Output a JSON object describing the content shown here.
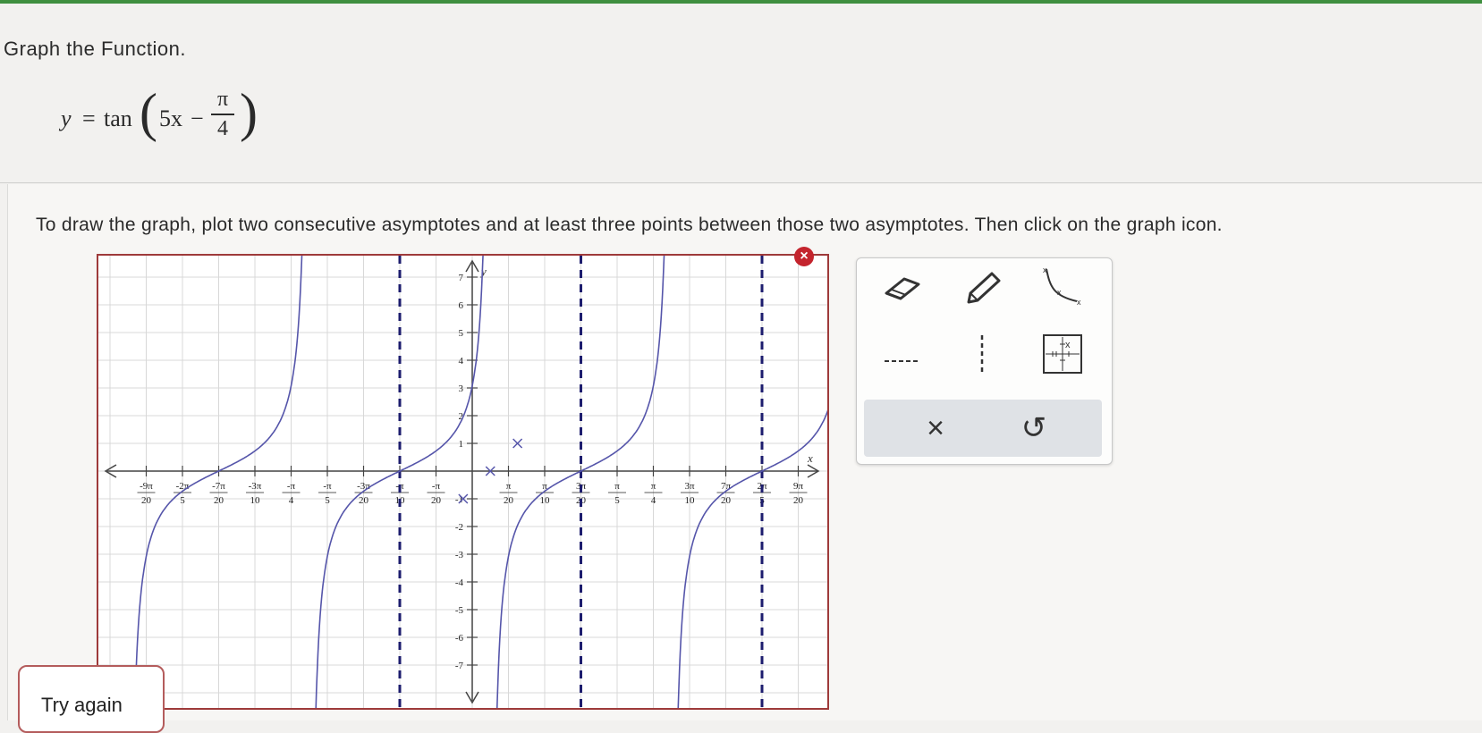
{
  "problem": {
    "title": "Graph the Function.",
    "formula": {
      "y": "y",
      "equals": "=",
      "func": "tan",
      "coef": "5x",
      "minus": "−",
      "num": "π",
      "den": "4"
    },
    "instructions": "To draw the graph, plot two consecutive asymptotes and at least three points between those two asymptotes. Then click on the graph icon."
  },
  "graph": {
    "axis_labels": {
      "x": "x",
      "y": "y"
    },
    "x_ticks": [
      {
        "num": "-9π",
        "den": "20",
        "v": -9
      },
      {
        "num": "-2π",
        "den": "5",
        "v": -8
      },
      {
        "num": "-7π",
        "den": "20",
        "v": -7
      },
      {
        "num": "-3π",
        "den": "10",
        "v": -6
      },
      {
        "num": "-π",
        "den": "4",
        "v": -5
      },
      {
        "num": "-π",
        "den": "5",
        "v": -4
      },
      {
        "num": "-3π",
        "den": "20",
        "v": -3
      },
      {
        "num": "-π",
        "den": "10",
        "v": -2
      },
      {
        "num": "-π",
        "den": "20",
        "v": -1
      },
      {
        "num": "π",
        "den": "20",
        "v": 1
      },
      {
        "num": "π",
        "den": "10",
        "v": 2
      },
      {
        "num": "3π",
        "den": "20",
        "v": 3
      },
      {
        "num": "π",
        "den": "5",
        "v": 4
      },
      {
        "num": "π",
        "den": "4",
        "v": 5
      },
      {
        "num": "3π",
        "den": "10",
        "v": 6
      },
      {
        "num": "7π",
        "den": "20",
        "v": 7
      },
      {
        "num": "2π",
        "den": "5",
        "v": 8
      },
      {
        "num": "9π",
        "den": "20",
        "v": 9
      }
    ],
    "y_ticks": [
      7,
      6,
      5,
      4,
      3,
      2,
      1,
      -1,
      -2,
      -3,
      -4,
      -5,
      -6,
      -7
    ],
    "asymptotes_units": [
      -2,
      3,
      8
    ],
    "curve_centers_units": [
      -7,
      -2,
      3,
      8
    ],
    "points": [
      {
        "x_units": 0.5,
        "y": 0
      },
      {
        "x_units": 1.25,
        "y": 1
      },
      {
        "x_units": -0.25,
        "y": -1
      }
    ],
    "colors": {
      "curve": "#5555aa",
      "grid": "#d8d8d8",
      "axis": "#444444",
      "asymptote": "#1d1d6e",
      "frame": "#9e3a3a"
    }
  },
  "toolbar": {
    "tools": [
      "eraser-icon",
      "pencil-icon",
      "tangent-curve-icon",
      "dashed-line-icon",
      "vertical-dashed-icon",
      "graph-grid-icon"
    ],
    "clear_symbol": "×",
    "undo_symbol": "↺"
  },
  "feedback": {
    "try_again": "Try again",
    "close_symbol": "×"
  }
}
